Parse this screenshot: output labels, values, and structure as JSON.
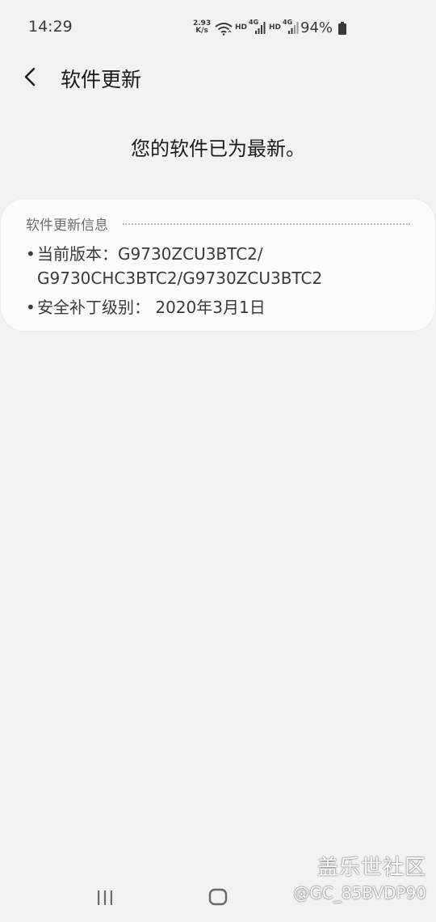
{
  "status_bar": {
    "time": "14:29",
    "net_speed_value": "2.93",
    "net_speed_unit": "K/s",
    "hd_1": "HD",
    "net_type_1": "4G",
    "hd_2": "HD",
    "net_type_2": "4G",
    "battery": "94%"
  },
  "header": {
    "title": "软件更新"
  },
  "main": {
    "status_message": "您的软件已为最新。"
  },
  "info_card": {
    "title": "软件更新信息",
    "bullet": "•",
    "current_version_label": "当前版本：",
    "current_version_line1": "G9730ZCU3BTC2/",
    "current_version_line2": "G9730CHC3BTC2/G9730ZCU3BTC2",
    "security_patch_label": "安全补丁级别：",
    "security_patch_value": "2020年3月1日"
  },
  "watermark": {
    "title": "盖乐世社区",
    "user": "@GC_85BVDP90"
  }
}
